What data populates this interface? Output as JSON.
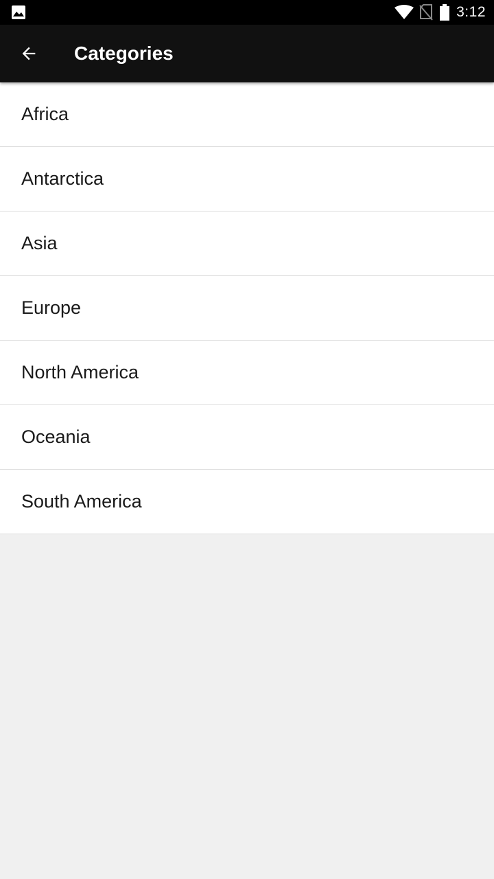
{
  "status_bar": {
    "time": "3:12",
    "icons": [
      "image-notification-icon",
      "wifi-icon",
      "no-sim-icon",
      "battery-icon"
    ]
  },
  "app_bar": {
    "back_icon": "arrow-back-icon",
    "title": "Categories"
  },
  "categories": [
    {
      "label": "Africa"
    },
    {
      "label": "Antarctica"
    },
    {
      "label": "Asia"
    },
    {
      "label": "Europe"
    },
    {
      "label": "North America"
    },
    {
      "label": "Oceania"
    },
    {
      "label": "South America"
    }
  ],
  "colors": {
    "status_bar": "#000000",
    "app_bar": "#111111",
    "list_background": "#ffffff",
    "page_background": "#f0f0f0",
    "divider": "#dedede"
  }
}
